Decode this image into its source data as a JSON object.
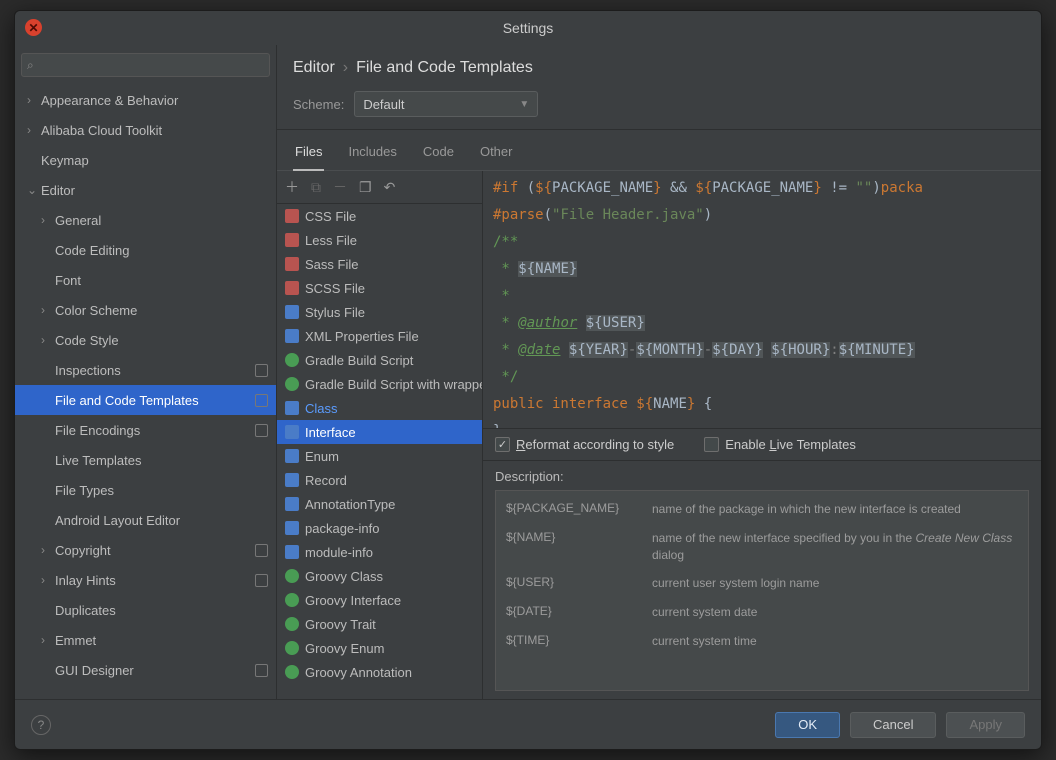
{
  "title": "Settings",
  "search_placeholder": "",
  "tree": [
    {
      "label": "Appearance & Behavior",
      "depth": 0,
      "chev": true
    },
    {
      "label": "Alibaba Cloud Toolkit",
      "depth": 0,
      "chev": true
    },
    {
      "label": "Keymap",
      "depth": 0,
      "chev": false
    },
    {
      "label": "Editor",
      "depth": 0,
      "chev": true,
      "open": true
    },
    {
      "label": "General",
      "depth": 1,
      "chev": true
    },
    {
      "label": "Code Editing",
      "depth": 1,
      "chev": false
    },
    {
      "label": "Font",
      "depth": 1,
      "chev": false
    },
    {
      "label": "Color Scheme",
      "depth": 1,
      "chev": true
    },
    {
      "label": "Code Style",
      "depth": 1,
      "chev": true
    },
    {
      "label": "Inspections",
      "depth": 1,
      "chev": false,
      "badge": true
    },
    {
      "label": "File and Code Templates",
      "depth": 1,
      "chev": false,
      "sel": true,
      "badge": true
    },
    {
      "label": "File Encodings",
      "depth": 1,
      "chev": false,
      "badge": true
    },
    {
      "label": "Live Templates",
      "depth": 1,
      "chev": false
    },
    {
      "label": "File Types",
      "depth": 1,
      "chev": false
    },
    {
      "label": "Android Layout Editor",
      "depth": 1,
      "chev": false
    },
    {
      "label": "Copyright",
      "depth": 1,
      "chev": true,
      "badge": true
    },
    {
      "label": "Inlay Hints",
      "depth": 1,
      "chev": true,
      "badge": true
    },
    {
      "label": "Duplicates",
      "depth": 1,
      "chev": false
    },
    {
      "label": "Emmet",
      "depth": 1,
      "chev": true
    },
    {
      "label": "GUI Designer",
      "depth": 1,
      "chev": false,
      "badge": true
    }
  ],
  "breadcrumb": [
    "Editor",
    "File and Code Templates"
  ],
  "scheme_label": "Scheme:",
  "scheme_value": "Default",
  "tabs": [
    {
      "label": "Files",
      "active": true
    },
    {
      "label": "Includes"
    },
    {
      "label": "Code"
    },
    {
      "label": "Other"
    }
  ],
  "files": [
    {
      "label": "CSS File",
      "icon": "red"
    },
    {
      "label": "Less File",
      "icon": "red"
    },
    {
      "label": "Sass File",
      "icon": "red"
    },
    {
      "label": "SCSS File",
      "icon": "red"
    },
    {
      "label": "Stylus File",
      "icon": "blue"
    },
    {
      "label": "XML Properties File",
      "icon": "blue"
    },
    {
      "label": "Gradle Build Script",
      "icon": "green"
    },
    {
      "label": "Gradle Build Script with wrapper",
      "icon": "green"
    },
    {
      "label": "Class",
      "icon": "blue",
      "class": true
    },
    {
      "label": "Interface",
      "icon": "blue",
      "sel": true
    },
    {
      "label": "Enum",
      "icon": "blue"
    },
    {
      "label": "Record",
      "icon": "blue"
    },
    {
      "label": "AnnotationType",
      "icon": "blue"
    },
    {
      "label": "package-info",
      "icon": "blue"
    },
    {
      "label": "module-info",
      "icon": "blue"
    },
    {
      "label": "Groovy Class",
      "icon": "green"
    },
    {
      "label": "Groovy Interface",
      "icon": "green"
    },
    {
      "label": "Groovy Trait",
      "icon": "green"
    },
    {
      "label": "Groovy Enum",
      "icon": "green"
    },
    {
      "label": "Groovy Annotation",
      "icon": "green"
    }
  ],
  "code_lines": [
    [
      {
        "t": "#if",
        "c": "pkg"
      },
      {
        "t": " (",
        "c": "white"
      },
      {
        "t": "${",
        "c": "brace"
      },
      {
        "t": "PACKAGE_NAME",
        "c": "white"
      },
      {
        "t": "}",
        "c": "brace"
      },
      {
        "t": " && ",
        "c": "white"
      },
      {
        "t": "${",
        "c": "brace"
      },
      {
        "t": "PACKAGE_NAME",
        "c": "white"
      },
      {
        "t": "}",
        "c": "brace"
      },
      {
        "t": " != ",
        "c": "white"
      },
      {
        "t": "\"\"",
        "c": "str"
      },
      {
        "t": ")",
        "c": "white"
      },
      {
        "t": "packa",
        "c": "kw"
      }
    ],
    [
      {
        "t": "#parse",
        "c": "pkg"
      },
      {
        "t": "(",
        "c": "white"
      },
      {
        "t": "\"File Header.java\"",
        "c": "str"
      },
      {
        "t": ")",
        "c": "white"
      }
    ],
    [
      {
        "t": "/**",
        "c": "doc"
      }
    ],
    [
      {
        "t": " * ",
        "c": "doc"
      },
      {
        "t": "${",
        "c": "docv"
      },
      {
        "t": "NAME",
        "c": "docv"
      },
      {
        "t": "}",
        "c": "docv"
      }
    ],
    [
      {
        "t": " *",
        "c": "doc"
      }
    ],
    [
      {
        "t": " * ",
        "c": "doc"
      },
      {
        "t": "@author",
        "c": "doctag"
      },
      {
        "t": " ",
        "c": "doc"
      },
      {
        "t": "${",
        "c": "docv"
      },
      {
        "t": "USER",
        "c": "docv"
      },
      {
        "t": "}",
        "c": "docv"
      }
    ],
    [
      {
        "t": " * ",
        "c": "doc"
      },
      {
        "t": "@date",
        "c": "doctag"
      },
      {
        "t": " ",
        "c": "doc"
      },
      {
        "t": "${",
        "c": "docv"
      },
      {
        "t": "YEAR",
        "c": "docv"
      },
      {
        "t": "}",
        "c": "docv"
      },
      {
        "t": "-",
        "c": "grey"
      },
      {
        "t": "${",
        "c": "docv"
      },
      {
        "t": "MONTH",
        "c": "docv"
      },
      {
        "t": "}",
        "c": "docv"
      },
      {
        "t": "-",
        "c": "grey"
      },
      {
        "t": "${",
        "c": "docv"
      },
      {
        "t": "DAY",
        "c": "docv"
      },
      {
        "t": "}",
        "c": "docv"
      },
      {
        "t": " ",
        "c": "doc"
      },
      {
        "t": "${",
        "c": "docv"
      },
      {
        "t": "HOUR",
        "c": "docv"
      },
      {
        "t": "}",
        "c": "docv"
      },
      {
        "t": ":",
        "c": "grey"
      },
      {
        "t": "${",
        "c": "docv"
      },
      {
        "t": "MINUTE",
        "c": "docv"
      },
      {
        "t": "}",
        "c": "docv"
      }
    ],
    [
      {
        "t": " */",
        "c": "doc"
      }
    ],
    [
      {
        "t": "public interface ",
        "c": "kw"
      },
      {
        "t": "${",
        "c": "brace"
      },
      {
        "t": "NAME",
        "c": "white"
      },
      {
        "t": "}",
        "c": "brace"
      },
      {
        "t": " {",
        "c": "white"
      }
    ],
    [
      {
        "t": "}",
        "c": "white"
      }
    ]
  ],
  "reformat_label": [
    "R",
    "eformat according to style"
  ],
  "reformat_checked": true,
  "live_label": [
    "Enable ",
    "L",
    "ive Templates"
  ],
  "live_checked": false,
  "description_label": "Description:",
  "desc_rows": [
    {
      "k": "${PACKAGE_NAME}",
      "v": "name of the package in which the new interface is created"
    },
    {
      "k": "${NAME}",
      "v": "name of the new interface specified by you in the <em>Create New Class</em> dialog"
    },
    {
      "k": "${USER}",
      "v": "current user system login name"
    },
    {
      "k": "${DATE}",
      "v": "current system date"
    },
    {
      "k": "${TIME}",
      "v": "current system time"
    }
  ],
  "buttons": {
    "ok": "OK",
    "cancel": "Cancel",
    "apply": "Apply"
  }
}
